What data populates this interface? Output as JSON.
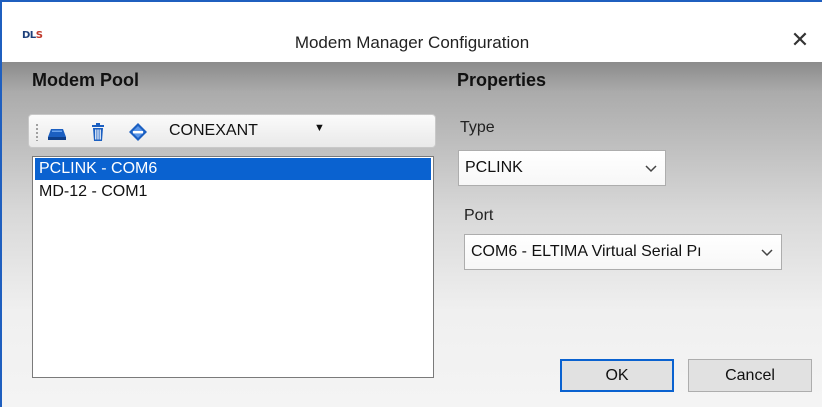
{
  "window": {
    "title": "Modem Manager Configuration",
    "logo_text_left": "DL",
    "logo_text_right": "S",
    "close_label": "✕"
  },
  "modem_pool": {
    "title": "Modem Pool",
    "toolbar": {
      "icons": [
        "add-modem-icon",
        "delete-icon",
        "modem-properties-icon"
      ],
      "combo_value": "CONEXANT",
      "combo_arrow": "▼"
    },
    "items": [
      {
        "label": "PCLINK - COM6",
        "selected": true
      },
      {
        "label": "MD-12 - COM1",
        "selected": false
      }
    ]
  },
  "properties": {
    "title": "Properties",
    "type_label": "Type",
    "type_value": "PCLINK",
    "port_label": "Port",
    "port_value": "COM6 - ELTIMA Virtual Serial Pı"
  },
  "buttons": {
    "ok": "OK",
    "cancel": "Cancel"
  },
  "colors": {
    "accent": "#0a62d0",
    "window_border": "#1f5fbf"
  }
}
